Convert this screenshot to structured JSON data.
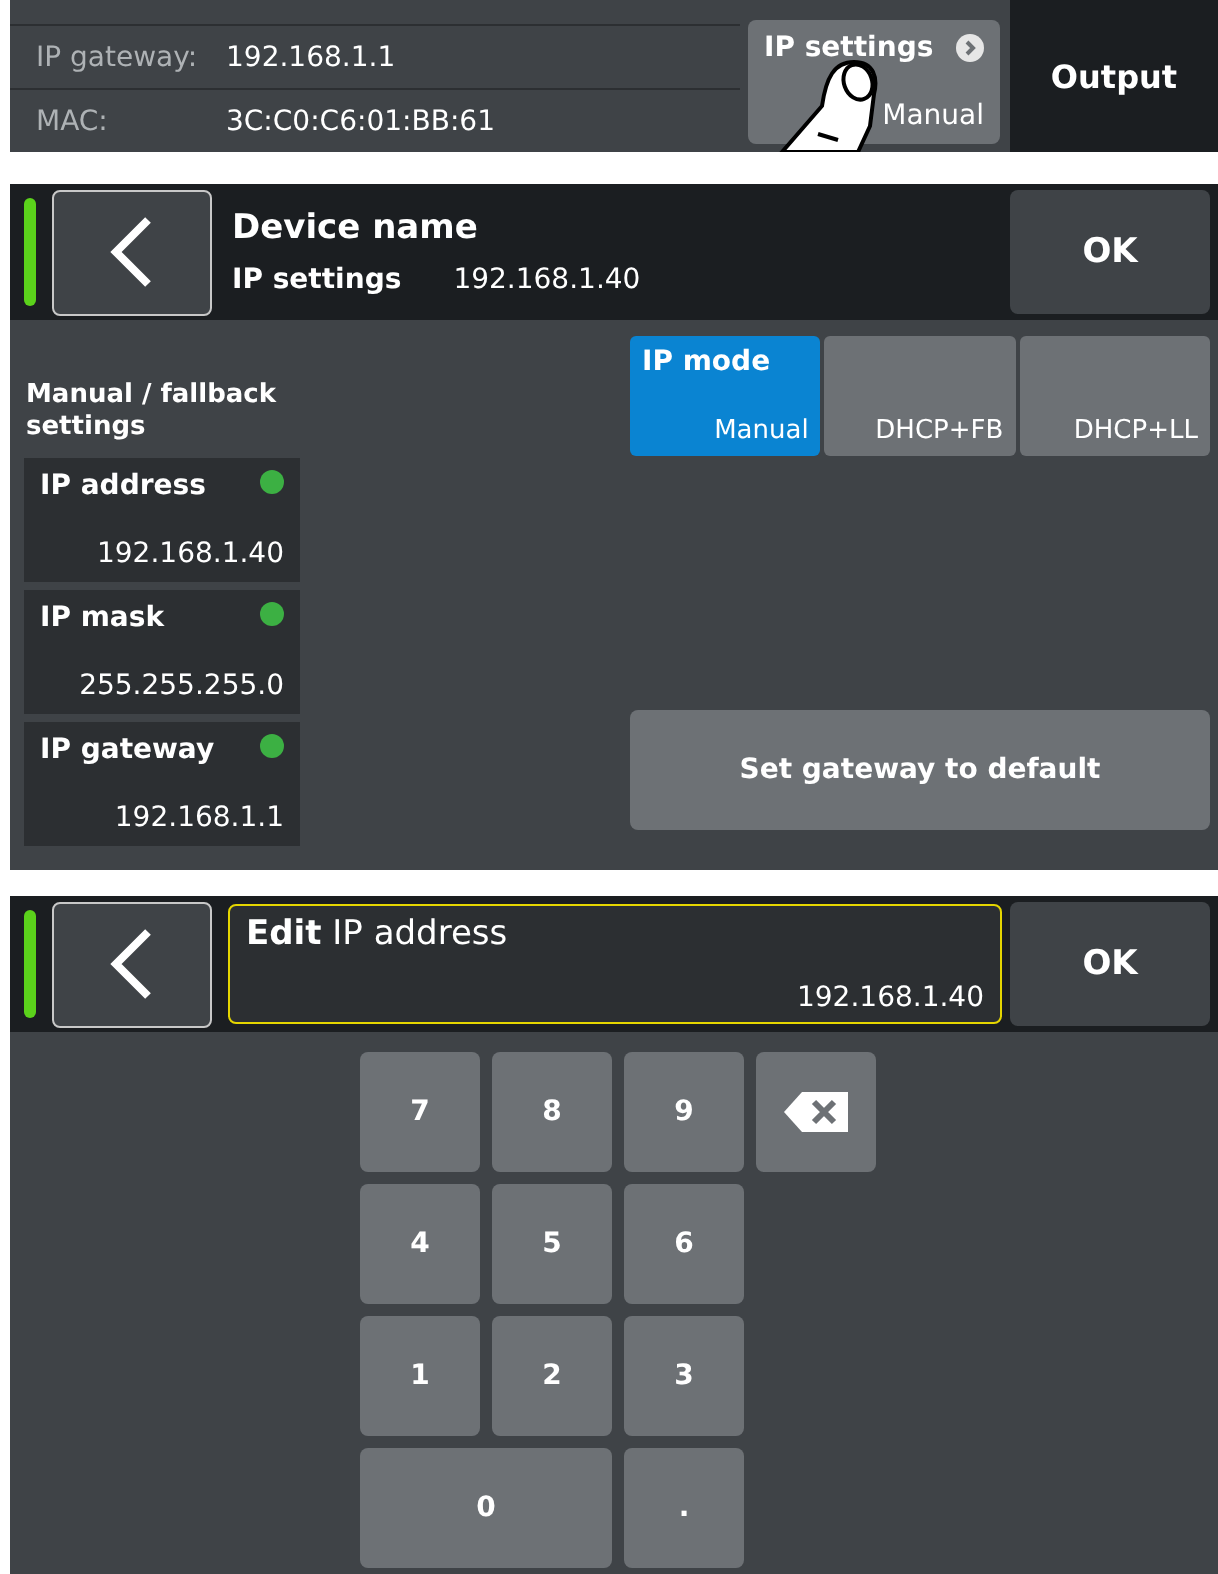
{
  "top_strip": {
    "rows": [
      {
        "label": "IP gateway:",
        "value": "192.168.1.1"
      },
      {
        "label": "MAC:",
        "value": "3C:C0:C6:01:BB:61"
      }
    ],
    "ip_settings_button": {
      "title": "IP settings",
      "value": "Manual"
    },
    "output_button": "Output"
  },
  "ip_settings_screen": {
    "header": {
      "title": "Device name",
      "subtitle_label": "IP settings",
      "subtitle_value": "192.168.1.40",
      "ok": "OK"
    },
    "section_title": "Manual / fallback settings",
    "fields": [
      {
        "label": "IP address",
        "value": "192.168.1.40",
        "color": "#3cb043"
      },
      {
        "label": "IP mask",
        "value": "255.255.255.0",
        "color": "#3cb043"
      },
      {
        "label": "IP gateway",
        "value": "192.168.1.1",
        "color": "#3cb043"
      }
    ],
    "ip_mode": {
      "label": "IP mode",
      "options": [
        {
          "label": "Manual",
          "selected": true
        },
        {
          "label": "DHCP+FB",
          "selected": false
        },
        {
          "label": "DHCP+LL",
          "selected": false
        }
      ]
    },
    "gateway_button": "Set gateway to default"
  },
  "edit_screen": {
    "title": "**Edit** IP address",
    "value": "192.168.1.40",
    "ok": "OK",
    "keys": [
      {
        "kind": "digit",
        "label": "7"
      },
      {
        "kind": "digit",
        "label": "8"
      },
      {
        "kind": "digit",
        "label": "9"
      },
      {
        "kind": "backspace"
      },
      {
        "kind": "digit",
        "label": "4"
      },
      {
        "kind": "digit",
        "label": "5"
      },
      {
        "kind": "digit",
        "label": "6"
      },
      {
        "kind": "gap"
      },
      {
        "kind": "digit",
        "label": "1"
      },
      {
        "kind": "digit",
        "label": "2"
      },
      {
        "kind": "digit",
        "label": "3"
      },
      {
        "kind": "gap"
      },
      {
        "kind": "wide",
        "label": "0"
      },
      {
        "kind": "digit",
        "label": "."
      }
    ]
  }
}
